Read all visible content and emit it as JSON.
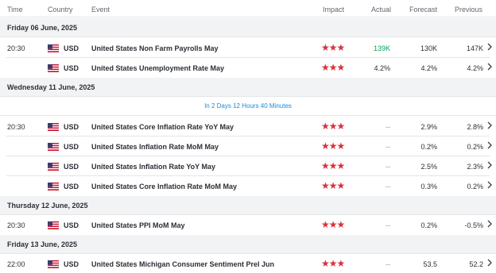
{
  "columns": {
    "time": "Time",
    "country": "Country",
    "event": "Event",
    "impact": "Impact",
    "actual": "Actual",
    "forecast": "Forecast",
    "previous": "Previous"
  },
  "dates": [
    "Friday 06 June, 2025",
    "Wednesday 11 June, 2025",
    "Thursday 12 June, 2025",
    "Friday 13 June, 2025"
  ],
  "countdown": "In 2 Days 12 Hours 40 Minutes",
  "impact_stars": "★★★",
  "colors": {
    "impact_red": "#d9313c",
    "actual_green": "#0fa15a",
    "countdown_blue": "#1a8bd8"
  },
  "events": [
    {
      "time": "20:30",
      "currency": "USD",
      "event": "United States Non Farm Payrolls May",
      "actual": "139K",
      "forecast": "130K",
      "previous": "147K"
    },
    {
      "time": "",
      "currency": "USD",
      "event": "United States Unemployment Rate May",
      "actual": "4.2%",
      "forecast": "4.2%",
      "previous": "4.2%"
    },
    {
      "time": "20:30",
      "currency": "USD",
      "event": "United States Core Inflation Rate YoY May",
      "actual": "--",
      "forecast": "2.9%",
      "previous": "2.8%"
    },
    {
      "time": "",
      "currency": "USD",
      "event": "United States Inflation Rate MoM May",
      "actual": "--",
      "forecast": "0.2%",
      "previous": "0.2%"
    },
    {
      "time": "",
      "currency": "USD",
      "event": "United States Inflation Rate YoY May",
      "actual": "--",
      "forecast": "2.5%",
      "previous": "2.3%"
    },
    {
      "time": "",
      "currency": "USD",
      "event": "United States Core Inflation Rate MoM May",
      "actual": "--",
      "forecast": "0.3%",
      "previous": "0.2%"
    },
    {
      "time": "20:30",
      "currency": "USD",
      "event": "United States PPI MoM May",
      "actual": "--",
      "forecast": "0.2%",
      "previous": "-0.5%"
    },
    {
      "time": "22:00",
      "currency": "USD",
      "event": "United States Michigan Consumer Sentiment Prel Jun",
      "actual": "--",
      "forecast": "53.5",
      "previous": "52.2"
    }
  ]
}
